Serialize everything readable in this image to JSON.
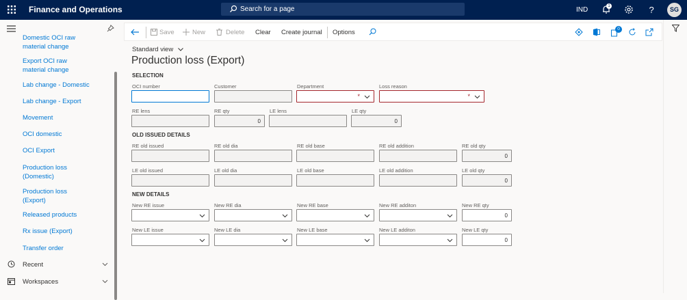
{
  "topbar": {
    "app_title": "Finance and Operations",
    "search_placeholder": "Search for a page",
    "company": "IND",
    "user_initials": "SG",
    "notification_count": "1"
  },
  "nav": {
    "items": [
      "Domestic OCI raw",
      "material change",
      "Export OCI raw",
      "material change",
      "Lab change - Domestic",
      "Lab change - Export",
      "Movement",
      "OCI domestic",
      "OCI Export",
      "Production loss",
      "(Domestic)",
      "Production loss",
      "(Export)",
      "Released products",
      "Rx issue (Export)",
      "Transfer order"
    ],
    "recent": "Recent",
    "workspaces": "Workspaces"
  },
  "actions": {
    "save": "Save",
    "new": "New",
    "delete": "Delete",
    "clear": "Clear",
    "create_journal": "Create journal",
    "options": "Options",
    "badge": "0"
  },
  "page": {
    "view": "Standard view",
    "title": "Production loss (Export)"
  },
  "sections": {
    "selection": "SELECTION",
    "old": "OLD ISSUED DETAILS",
    "new": "NEW DETAILS"
  },
  "labels": {
    "oci_number": "OCI number",
    "customer": "Customer",
    "department": "Department",
    "loss_reason": "Loss reason",
    "re_lens": "RE lens",
    "re_qty": "RE qty",
    "le_lens": "LE lens",
    "le_qty": "LE qty",
    "re_old_issued": "RE old issued",
    "re_old_dia": "RE old dia",
    "re_old_base": "RE old base",
    "re_old_addition": "RE old addition",
    "re_old_qty": "RE old qty",
    "le_old_issued": "LE old issued",
    "le_old_dia": "LE old dia",
    "le_old_base": "LE old base",
    "le_old_addition": "LE old addition",
    "le_old_qty": "LE old qty",
    "new_re_issue": "New RE issue",
    "new_re_dia": "New RE dia",
    "new_re_base": "New RE base",
    "new_re_addition": "New RE additon",
    "new_re_qty": "New RE qty",
    "new_le_issue": "New LE issue",
    "new_le_dia": "New LE dia",
    "new_le_base": "New LE base",
    "new_le_addition": "New LE additon",
    "new_le_qty": "New LE qty"
  },
  "values": {
    "re_qty": "0",
    "le_qty": "0",
    "re_old_qty": "0",
    "le_old_qty": "0",
    "new_re_qty": "0",
    "new_le_qty": "0",
    "required_marker": "*"
  }
}
